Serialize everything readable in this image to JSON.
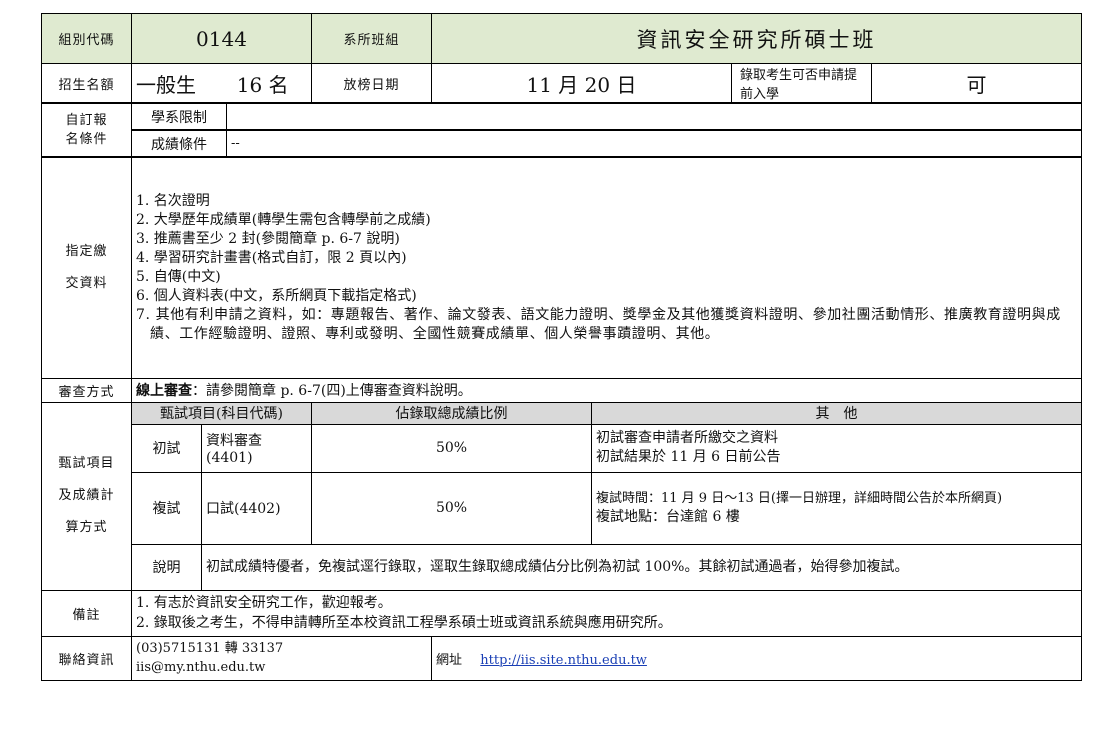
{
  "header": {
    "group_code_label": "組別代碼",
    "group_code": "0144",
    "dept_label": "系所班組",
    "dept_name": "資訊安全研究所碩士班"
  },
  "quota": {
    "label": "招生名額",
    "category": "一般生",
    "count": "16 名",
    "release_label": "放榜日期",
    "release_date": "11 月 20 日",
    "early_label": "錄取考生可否申請提前入學",
    "early_value": "可"
  },
  "conditions": {
    "label_line1": "自訂報",
    "label_line2": "名條件",
    "dept_limit_label": "學系限制",
    "dept_limit_value": "",
    "grade_label": "成績條件",
    "grade_value": "--"
  },
  "documents": {
    "label_line1": "指定繳",
    "label_line2": "交資料",
    "items": [
      "1. 名次證明",
      "2. 大學歷年成績單(轉學生需包含轉學前之成績)",
      "3. 推薦書至少 2 封(參閱簡章 p. 6-7 說明)",
      "4. 學習研究計畫書(格式自訂，限 2 頁以內)",
      "5. 自傳(中文)",
      "6. 個人資料表(中文，系所網頁下載指定格式)",
      "7. 其他有利申請之資料，如：專題報告、著作、論文發表、語文能力證明、獎學金及其他獲獎資料證明、參加社團活動情形、推廣教育證明與成績、工作經驗證明、證照、專利或發明、全國性競賽成績單、個人榮譽事蹟證明、其他。"
    ]
  },
  "review": {
    "label": "審查方式",
    "method_bold": "線上審查",
    "method_text": "：請參閱簡章 p. 6-7(四)上傳審查資料說明。"
  },
  "exam": {
    "label_line1": "甄試項目",
    "label_line2": "及成績計",
    "label_line3": "算方式",
    "col_item": "甄試項目(科目代碼)",
    "col_ratio": "佔錄取總成績比例",
    "col_other": "其　他",
    "rows": [
      {
        "stage": "初試",
        "item": "資料審查(4401)",
        "ratio": "50%",
        "other_line1": "初試審查申請者所繳交之資料",
        "other_line2": "初試結果於 11 月 6 日前公告"
      },
      {
        "stage": "複試",
        "item": "口試(4402)",
        "ratio": "50%",
        "other_line1": "複試時間：11 月 9 日～13 日(擇一日辦理，詳細時間公告於本所網頁)",
        "other_line2": "複試地點：台達館 6 樓"
      }
    ],
    "note_label": "說明",
    "note_text": "初試成績特優者，免複試逕行錄取，逕取生錄取總成績佔分比例為初試 100%。其餘初試通過者，始得參加複試。"
  },
  "remarks": {
    "label": "備註",
    "line1": "1. 有志於資訊安全研究工作，歡迎報考。",
    "line2": "2. 錄取後之考生，不得申請轉所至本校資訊工程學系碩士班或資訊系統與應用研究所。"
  },
  "contact": {
    "label": "聯絡資訊",
    "phone": "(03)5715131 轉 33137",
    "email": "iis@my.nthu.edu.tw",
    "website_label": "網址",
    "website": "http://iis.site.nthu.edu.tw"
  }
}
